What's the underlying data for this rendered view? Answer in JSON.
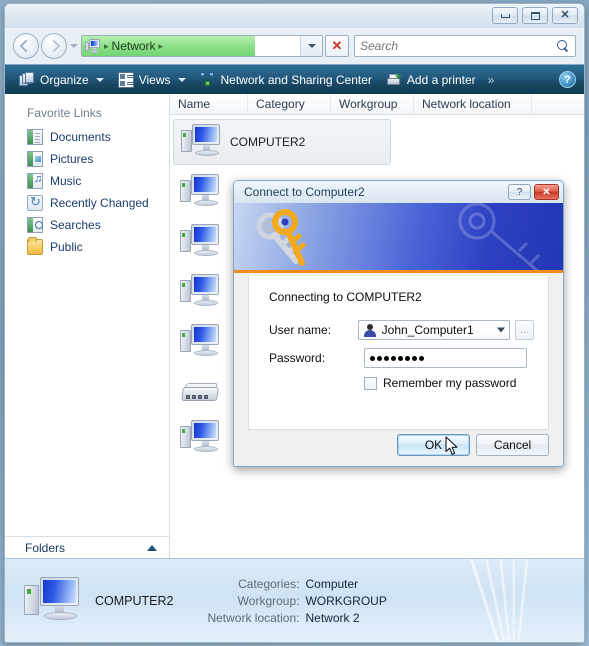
{
  "window": {
    "controls": {
      "minimize": "Minimize",
      "maximize": "Maximize",
      "close": "Close"
    }
  },
  "navigation": {
    "back_label": "Back",
    "forward_label": "Forward",
    "history_label": "Recent pages",
    "breadcrumb_root_icon": "network-icon",
    "breadcrumb": "Network",
    "separator": "▸",
    "dropdown_label": "Previous Locations",
    "stop_label": "✕"
  },
  "search": {
    "placeholder": "Search",
    "value": "",
    "icon": "search-icon"
  },
  "toolbar": {
    "organize": "Organize",
    "views": "Views",
    "network_sharing": "Network and Sharing Center",
    "add_printer": "Add a printer",
    "overflow": "»",
    "help": "?"
  },
  "sidebar": {
    "title": "Favorite Links",
    "items": [
      {
        "label": "Documents",
        "icon": "documents-icon"
      },
      {
        "label": "Pictures",
        "icon": "pictures-icon"
      },
      {
        "label": "Music",
        "icon": "music-icon"
      },
      {
        "label": "Recently Changed",
        "icon": "recently-changed-icon"
      },
      {
        "label": "Searches",
        "icon": "searches-icon"
      },
      {
        "label": "Public",
        "icon": "public-folder-icon"
      }
    ],
    "folders_label": "Folders",
    "folders_chevron": "chevron-up-icon"
  },
  "filelist": {
    "columns": [
      "Name",
      "Category",
      "Workgroup",
      "Network location"
    ],
    "items": [
      {
        "label": "COMPUTER2",
        "icon": "computer-icon",
        "selected": true
      },
      {
        "label": "",
        "icon": "computer-icon",
        "selected": false
      },
      {
        "label": "",
        "icon": "computer-icon",
        "selected": false
      },
      {
        "label": "",
        "icon": "computer-icon",
        "selected": false
      },
      {
        "label": "",
        "icon": "computer-icon",
        "selected": false
      },
      {
        "label": "",
        "icon": "router-icon",
        "selected": false
      },
      {
        "label": "",
        "icon": "computer-icon",
        "selected": false
      }
    ]
  },
  "details": {
    "name": "COMPUTER2",
    "icon": "computer-icon",
    "rows": [
      {
        "label": "Categories:",
        "value": "Computer"
      },
      {
        "label": "Workgroup:",
        "value": "WORKGROUP"
      },
      {
        "label": "Network location:",
        "value": "Network 2"
      }
    ]
  },
  "dialog": {
    "title": "Connect to Computer2",
    "help_button": "?",
    "close_button": "✕",
    "banner_icon": "keys-icon",
    "connecting_text": "Connecting to COMPUTER2",
    "username_label": "User name:",
    "username_value": "John_Computer1",
    "username_icon": "user-icon",
    "browse_button": "...",
    "password_label": "Password:",
    "password_value": "••••••••",
    "password_dots": 8,
    "remember_label": "Remember my password",
    "remember_checked": false,
    "ok_label": "OK",
    "cancel_label": "Cancel"
  },
  "colors": {
    "toolbar": "#17455f",
    "address_progress": "#8ee08a",
    "dialog_banner": "#2b3fc0",
    "banner_accent": "#f08a1e",
    "close_red": "#c63926",
    "link_blue": "#1a3d6b"
  }
}
